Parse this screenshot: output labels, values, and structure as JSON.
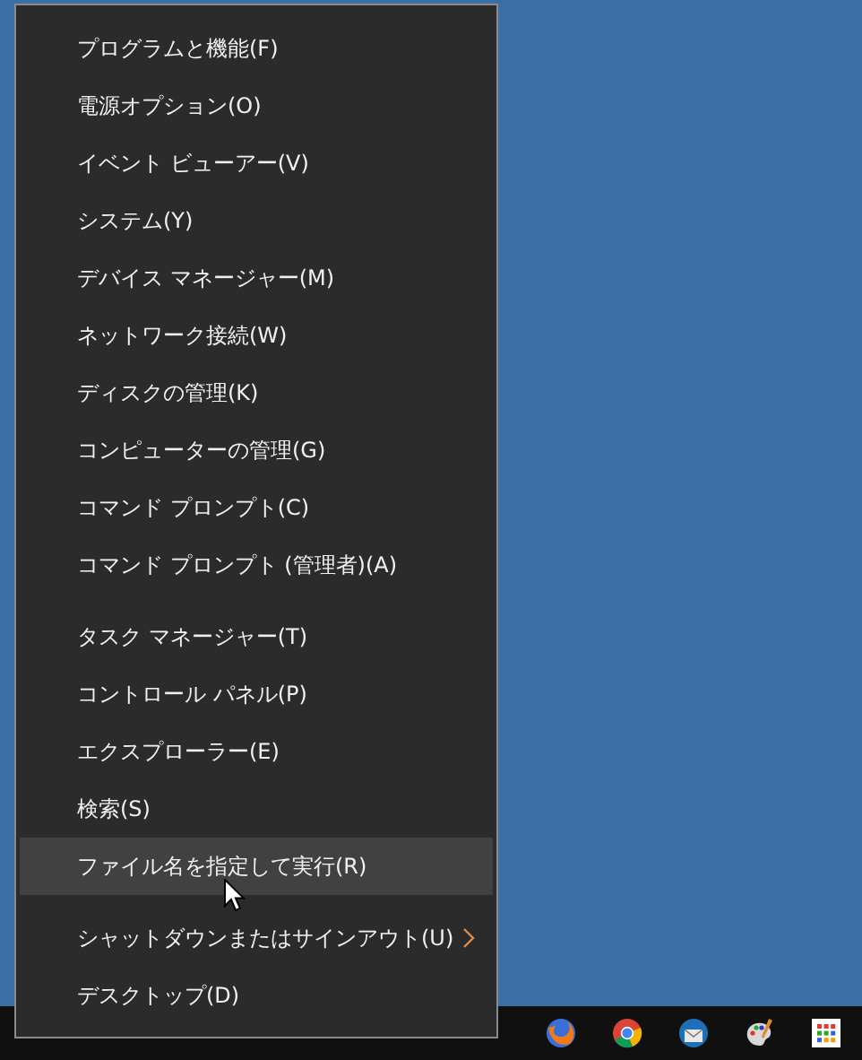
{
  "menu": {
    "groups": [
      {
        "items": [
          {
            "label": "プログラムと機能(F)",
            "selected": false,
            "has_submenu": false
          },
          {
            "label": "電源オプション(O)",
            "selected": false,
            "has_submenu": false
          },
          {
            "label": "イベント ビューアー(V)",
            "selected": false,
            "has_submenu": false
          },
          {
            "label": "システム(Y)",
            "selected": false,
            "has_submenu": false
          },
          {
            "label": "デバイス マネージャー(M)",
            "selected": false,
            "has_submenu": false
          },
          {
            "label": "ネットワーク接続(W)",
            "selected": false,
            "has_submenu": false
          },
          {
            "label": "ディスクの管理(K)",
            "selected": false,
            "has_submenu": false
          },
          {
            "label": "コンピューターの管理(G)",
            "selected": false,
            "has_submenu": false
          },
          {
            "label": "コマンド プロンプト(C)",
            "selected": false,
            "has_submenu": false
          },
          {
            "label": "コマンド プロンプト (管理者)(A)",
            "selected": false,
            "has_submenu": false
          }
        ]
      },
      {
        "items": [
          {
            "label": "タスク マネージャー(T)",
            "selected": false,
            "has_submenu": false
          },
          {
            "label": "コントロール パネル(P)",
            "selected": false,
            "has_submenu": false
          },
          {
            "label": "エクスプローラー(E)",
            "selected": false,
            "has_submenu": false
          },
          {
            "label": "検索(S)",
            "selected": false,
            "has_submenu": false
          },
          {
            "label": "ファイル名を指定して実行(R)",
            "selected": true,
            "has_submenu": false
          }
        ]
      },
      {
        "items": [
          {
            "label": "シャットダウンまたはサインアウト(U)",
            "selected": false,
            "has_submenu": true
          },
          {
            "label": "デスクトップ(D)",
            "selected": false,
            "has_submenu": false
          }
        ]
      }
    ]
  },
  "taskbar": {
    "icons": [
      {
        "kind": "firefox"
      },
      {
        "kind": "chrome"
      },
      {
        "kind": "mail"
      },
      {
        "kind": "paint"
      },
      {
        "kind": "store"
      }
    ]
  }
}
